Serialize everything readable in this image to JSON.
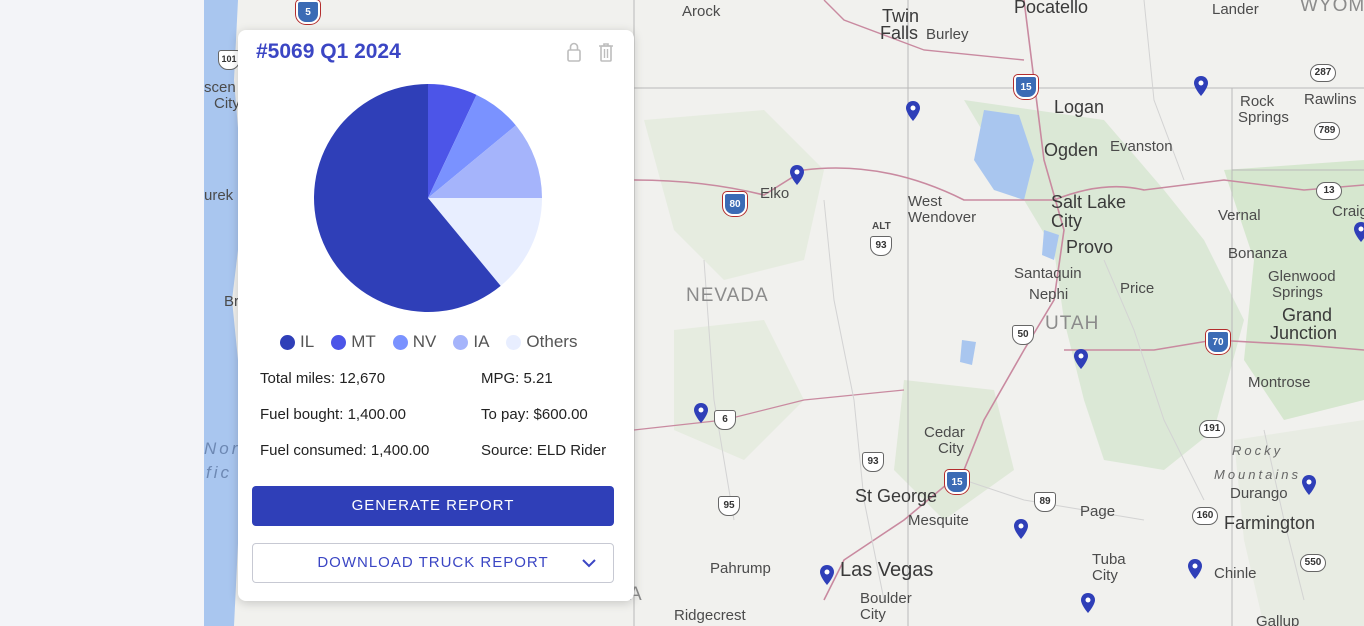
{
  "card": {
    "title": "#5069 Q1 2024",
    "icons": [
      "lock-icon",
      "trash-icon"
    ],
    "pie": {
      "slices": [
        {
          "name": "IL",
          "value": 61,
          "color": "#2f3fb8"
        },
        {
          "name": "MT",
          "value": 7,
          "color": "#4c55e8"
        },
        {
          "name": "NV",
          "value": 7,
          "color": "#7a92ff"
        },
        {
          "name": "IA",
          "value": 11,
          "color": "#a5b4fb"
        },
        {
          "name": "Others",
          "value": 14,
          "color": "#e8eeff"
        }
      ]
    },
    "legend": [
      "IL",
      "MT",
      "NV",
      "IA",
      "Others"
    ],
    "stats": {
      "total_miles_label": "Total miles:",
      "total_miles": "12,670",
      "mpg_label": "MPG:",
      "mpg": "5.21",
      "fuel_bought_label": "Fuel bought:",
      "fuel_bought": "1,400.00",
      "to_pay_label": "To pay:",
      "to_pay": "$600.00",
      "fuel_consumed_label": "Fuel consumed:",
      "fuel_consumed": "1,400.00",
      "source_label": "Source:",
      "source": "ELD Rider"
    },
    "generate_label": "GENERATE REPORT",
    "download_label": "DOWNLOAD TRUCK REPORT"
  },
  "map": {
    "labels": {
      "arock": "Arock",
      "twin_falls": "Twin\nFalls",
      "burley": "Burley",
      "pocatello": "Pocatello",
      "lander": "Lander",
      "wyoming": "WYOMI",
      "rock_springs": "Rock\nSprings",
      "rawlins": "Rawlins",
      "logan": "Logan",
      "ogden": "Ogden",
      "evanston": "Evanston",
      "elko": "Elko",
      "west_wendover": "West\nWendover",
      "salt_lake_city": "Salt Lake\nCity",
      "vernal": "Vernal",
      "craig": "Craig",
      "provo": "Provo",
      "bonanza": "Bonanza",
      "glenwood_springs": "Glenwood\nSprings",
      "santaquin": "Santaquin",
      "nephi": "Nephi",
      "price": "Price",
      "nevada": "NEVADA",
      "utah": "UTAH",
      "grand_junction": "Grand\nJunction",
      "montrose": "Montrose",
      "cedar_city": "Cedar\nCity",
      "rocky_mountains": "Rocky\nMountains",
      "st_george": "St George",
      "page": "Page",
      "durango": "Durango",
      "mesquite": "Mesquite",
      "farmington": "Farmington",
      "pahrump": "Pahrump",
      "las_vegas": "Las Vegas",
      "tuba_city": "Tuba\nCity",
      "chinle": "Chinle",
      "boulder_city": "Boulder\nCity",
      "ridgecrest": "Ridgecrest",
      "gallup": "Gallup",
      "north_pacific": "Nor\nfic",
      "scent_city": "scen\nCity",
      "urek": "urek",
      "br": "Br",
      "a_edge": "A"
    },
    "shields": {
      "i5": "5",
      "s101": "101",
      "i15a": "15",
      "s287": "287",
      "s789": "789",
      "i80": "80",
      "alt93": "93",
      "s13": "13",
      "s50": "50",
      "i70": "70",
      "us6": "6",
      "s191": "191",
      "us93": "93",
      "i15b": "15",
      "s89": "89",
      "us95": "95",
      "s160": "160",
      "s550": "550"
    },
    "alt_label": "ALT"
  }
}
